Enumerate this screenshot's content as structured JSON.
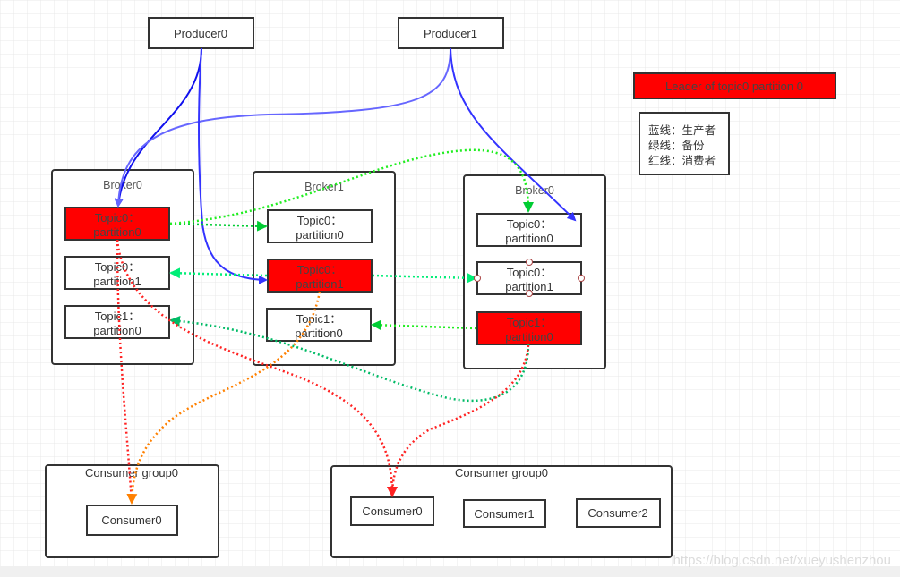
{
  "producers": [
    {
      "label": "Producer0"
    },
    {
      "label": "Producer1"
    }
  ],
  "leader_note": "Leader of topic0 partition 0",
  "legend": [
    "蓝线：生产者",
    "绿线：备份",
    "红线：消费者"
  ],
  "brokers": [
    {
      "title": "Broker0",
      "partitions": [
        {
          "l1": "Topic0：",
          "l2": "partition0",
          "leader": true
        },
        {
          "l1": "Topic0：",
          "l2": "partition1",
          "leader": false
        },
        {
          "l1": "Topic1：",
          "l2": "partition0",
          "leader": false
        }
      ]
    },
    {
      "title": "Broker1",
      "partitions": [
        {
          "l1": "Topic0：",
          "l2": "partition0",
          "leader": false
        },
        {
          "l1": "Topic0：",
          "l2": "partition1",
          "leader": true
        },
        {
          "l1": "Topic1：",
          "l2": "partition0",
          "leader": false
        }
      ]
    },
    {
      "title": "Broker0",
      "partitions": [
        {
          "l1": "Topic0：",
          "l2": "partition0",
          "leader": false
        },
        {
          "l1": "Topic0：",
          "l2": "partition1",
          "leader": false
        },
        {
          "l1": "Topic1：",
          "l2": "partition0",
          "leader": true
        }
      ]
    }
  ],
  "consumer_groups": [
    {
      "title": "Consumer group0",
      "consumers": [
        "Consumer0"
      ]
    },
    {
      "title": "Consumer group0",
      "consumers": [
        "Consumer0",
        "Consumer1",
        "Consumer2"
      ]
    }
  ],
  "colors": {
    "leader": "#ff0000",
    "producer_line": "#3333ff",
    "replica_line": "#00dd55",
    "consumer_line": "#ff0000",
    "consumer_line_alt": "#ff8000"
  },
  "watermark": "https://blog.csdn.net/xueyushenzhou"
}
